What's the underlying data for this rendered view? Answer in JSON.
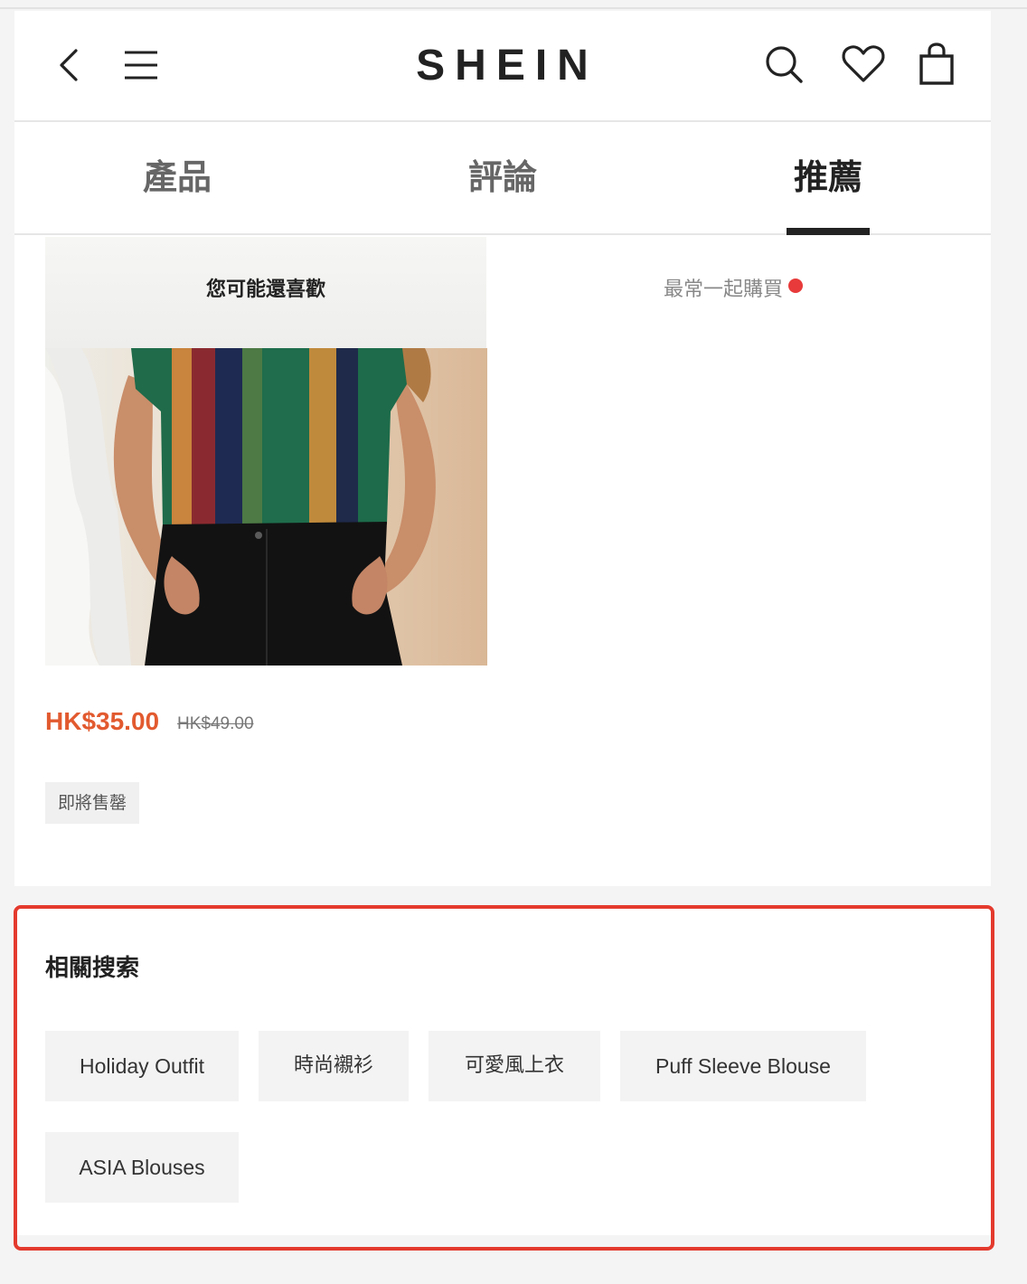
{
  "header": {
    "logo": "SHEIN",
    "icons": [
      "back-icon",
      "menu-icon",
      "search-icon",
      "heart-icon",
      "bag-icon"
    ]
  },
  "tabs": [
    {
      "label": "產品"
    },
    {
      "label": "評論"
    },
    {
      "label": "推薦"
    }
  ],
  "active_tab": "推薦",
  "subtabs": [
    {
      "label": "您可能還喜歡"
    },
    {
      "label": "最常一起購買"
    }
  ],
  "product": {
    "price": "HK$35.00",
    "original_price": "HK$49.00",
    "badge": "即將售罄"
  },
  "related": {
    "title": "相關搜索",
    "chips": [
      {
        "label": "Holiday Outfit"
      },
      {
        "label": "時尚襯衫"
      },
      {
        "label": "可愛風上衣"
      },
      {
        "label": "Puff Sleeve Blouse"
      },
      {
        "label": "ASIA Blouses"
      }
    ]
  },
  "colors": {
    "price": "#e25a2f",
    "highlight_border": "#e43a2e",
    "notification_dot": "#e83a3a"
  }
}
